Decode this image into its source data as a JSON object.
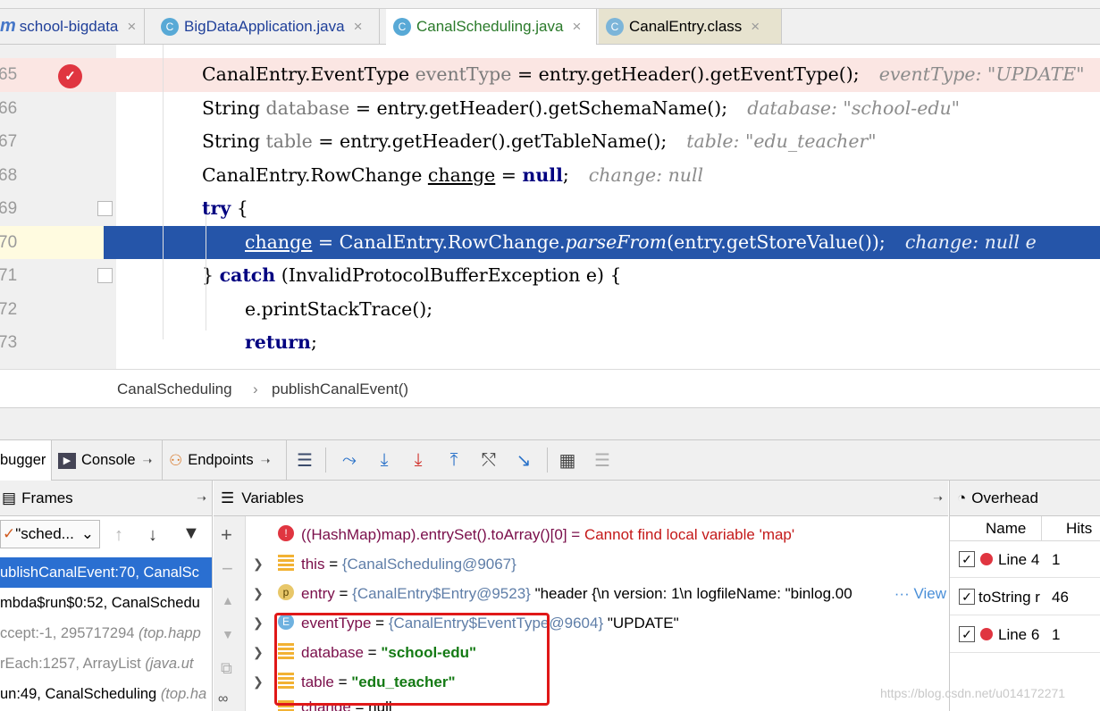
{
  "tabs": [
    {
      "label": "school-bigdata",
      "close": "×"
    },
    {
      "label": "BigDataApplication.java",
      "close": "×"
    },
    {
      "label": "CanalScheduling.java",
      "close": "×"
    },
    {
      "label": "CanalEntry.class",
      "close": "×"
    }
  ],
  "editor": {
    "lines": [
      {
        "num": "65",
        "p1": "CanalEntry.EventType ",
        "var": "eventType",
        "p2": " = entry.getHeader().getEventType();",
        "hint": "eventType: \"UPDATE\""
      },
      {
        "num": "66",
        "p1": "String ",
        "var": "database",
        "p2": " = entry.getHeader().getSchemaName();",
        "hint": "database: \"school-edu\""
      },
      {
        "num": "67",
        "p1": "String ",
        "var": "table",
        "p2": " = entry.getHeader().getTableName();",
        "hint": "table: \"edu_teacher\""
      },
      {
        "num": "68",
        "p1": "CanalEntry.RowChange ",
        "var": "change",
        "p2": " = ",
        "kw": "null",
        "p3": ";",
        "hint": "change: null"
      },
      {
        "num": "69",
        "kw": "try",
        "p1": " {"
      },
      {
        "num": "70",
        "var": "change",
        "p1": " = CanalEntry.RowChange.",
        "method": "parseFrom",
        "p2": "(entry.getStoreValue());",
        "hint": "change: null   e"
      },
      {
        "num": "71",
        "p1": "} ",
        "kw": "catch",
        "p2": " (InvalidProtocolBufferException e) {"
      },
      {
        "num": "72",
        "p1": "e.printStackTrace();"
      },
      {
        "num": "73",
        "kw": "return",
        "p1": ";"
      }
    ]
  },
  "breadcrumb": {
    "items": [
      "CanalScheduling",
      "publishCanalEvent()"
    ],
    "sep": "›"
  },
  "debugger": {
    "tabs": {
      "debugger": "bugger",
      "console": "Console",
      "endpoints": "Endpoints"
    }
  },
  "frames": {
    "title": "Frames",
    "thread": "\"sched...",
    "rows": [
      {
        "text": "ublishCanalEvent:70, CanalSc",
        "gray": ""
      },
      {
        "text": "mbda$run$0:52, CanalSchedu",
        "gray": ""
      },
      {
        "text": "ccept:-1, 295717294 ",
        "gray": "(top.happ"
      },
      {
        "text": "rEach:1257, ArrayList ",
        "gray": "(java.ut"
      },
      {
        "text": "un:49, CanalScheduling ",
        "gray": "(top.ha"
      }
    ]
  },
  "variables": {
    "title": "Variables",
    "error": {
      "expr": "((HashMap)map).entrySet().toArray()[0] = ",
      "msg": "Cannot find local variable 'map'"
    },
    "rows": [
      {
        "name": "this",
        "eq": " = ",
        "ref": "{CanalScheduling@9067}",
        "val": ""
      },
      {
        "name": "entry",
        "eq": " = ",
        "ref": "{CanalEntry$Entry@9523}",
        "val": " \"header {\\n  version: 1\\n  logfileName: \"binlog.00",
        "extra": "··· View"
      },
      {
        "name": "eventType",
        "eq": " = ",
        "ref": "{CanalEntry$EventType@9604}",
        "val": " \"UPDATE\""
      },
      {
        "name": "database",
        "eq": " = ",
        "ref": "",
        "str": "\"school-edu\""
      },
      {
        "name": "table",
        "eq": " = ",
        "ref": "",
        "str": "\"edu_teacher\""
      },
      {
        "name": "change",
        "eq": " = ",
        "ref": "",
        "val": "null"
      }
    ]
  },
  "overhead": {
    "title": "Overhead",
    "cols": [
      "Name",
      "Hits"
    ],
    "rows": [
      {
        "name": "Line 4",
        "hits": "1"
      },
      {
        "name": "toString r",
        "hits": "46"
      },
      {
        "name": "Line 6",
        "hits": "1"
      }
    ]
  },
  "watermark": "https://blog.csdn.net/u014172271"
}
